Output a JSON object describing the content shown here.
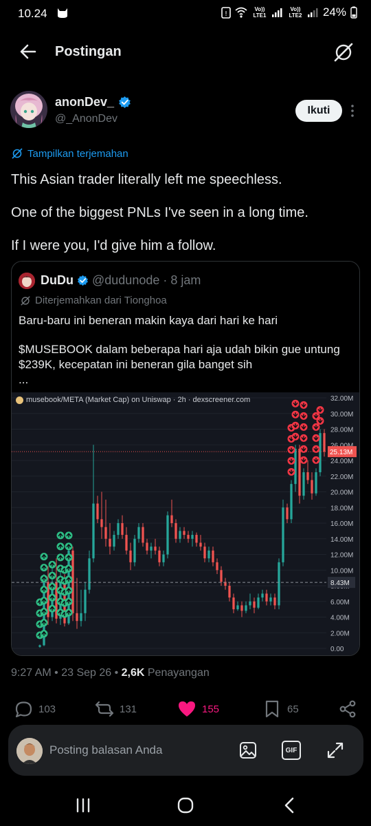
{
  "status_bar": {
    "time": "10.24",
    "sim1": "Vo)) LTE1",
    "sim2": "Vo)) LTE2",
    "battery": "24%"
  },
  "header": {
    "title": "Postingan",
    "back_icon": "arrow-left-icon",
    "grok_icon": "grok-icon"
  },
  "post": {
    "author_name": "anonDev_",
    "author_handle": "@_AnonDev",
    "follow_label": "Ikuti",
    "translate_label": "Tampilkan terjemahan",
    "text_lines": [
      "This Asian trader literally left me speechless.",
      "One of the biggest PNLs I've seen in a long time.",
      "If I were you, I'd give him a follow."
    ],
    "timestamp": "9:27 AM • 23 Sep 26 • ",
    "views": "2,6K",
    "views_label": " Penayangan"
  },
  "quote": {
    "name": "DuDu",
    "handle": "@dudunode",
    "time": "· 8 jam",
    "translated_from": "Diterjemahkan dari Tionghoa",
    "line1": "Baru-baru ini beneran makin kaya dari hari ke hari",
    "line2": "$MUSEBOOK dalam beberapa hari aja udah bikin gue untung",
    "line3": "$239K, kecepatan ini beneran gila banget sih",
    "ellipsis": "..."
  },
  "actions": {
    "replies": "103",
    "reposts": "131",
    "likes": "155",
    "bookmarks": "65",
    "like_color": "#f91880"
  },
  "reply_bar": {
    "placeholder": "Posting balasan Anda",
    "gif_label": "GIF"
  },
  "colors": {
    "accent": "#1d9bf0",
    "up": "#26a69a",
    "down": "#ef5350",
    "buy_marker": "#2ebd85",
    "sell_marker": "#f23645"
  },
  "chart_data": {
    "type": "candlestick",
    "title": "musebook/META (Market Cap) on Uniswap · 2h · dexscreener.com",
    "y_ticks": [
      "0.00",
      "2.00M",
      "4.00M",
      "6.00M",
      "8.00M",
      "10.00M",
      "12.00M",
      "14.00M",
      "16.00M",
      "18.00M",
      "20.00M",
      "22.00M",
      "24.00M",
      "26.00M",
      "28.00M",
      "30.00M",
      "32.00M"
    ],
    "ylim": [
      0,
      32
    ],
    "unit": "M",
    "last_price_label": "25.13M",
    "last_price": 25.13,
    "crosshair_label": "8.43M",
    "crosshair_value": 8.43,
    "candles": [
      [
        0.2,
        0.5,
        0.1,
        0.4
      ],
      [
        0.4,
        9.5,
        0.3,
        8.5
      ],
      [
        8.5,
        10.5,
        3.0,
        4.0
      ],
      [
        4.0,
        11.0,
        3.5,
        8.5
      ],
      [
        8.5,
        11.5,
        3.2,
        3.8
      ],
      [
        3.8,
        10.0,
        3.0,
        9.0
      ],
      [
        9.0,
        9.5,
        2.8,
        3.2
      ],
      [
        3.2,
        13.5,
        3.0,
        12.5
      ],
      [
        12.5,
        13.0,
        3.5,
        4.5
      ],
      [
        4.5,
        9.0,
        2.5,
        3.5
      ],
      [
        3.5,
        7.5,
        2.8,
        4.5
      ],
      [
        4.5,
        8.5,
        3.5,
        7.5
      ],
      [
        7.5,
        12.5,
        7.0,
        11.5
      ],
      [
        11.5,
        26.0,
        11.0,
        18.5
      ],
      [
        18.5,
        19.5,
        16.0,
        16.5
      ],
      [
        16.5,
        20.0,
        14.0,
        15.5
      ],
      [
        15.5,
        19.0,
        13.0,
        14.0
      ],
      [
        14.0,
        16.0,
        12.0,
        13.0
      ],
      [
        13.0,
        15.0,
        12.5,
        14.5
      ],
      [
        14.5,
        16.5,
        14.0,
        16.0
      ],
      [
        16.0,
        17.0,
        14.0,
        14.5
      ],
      [
        14.5,
        15.5,
        12.0,
        12.5
      ],
      [
        12.5,
        13.5,
        10.0,
        11.0
      ],
      [
        11.0,
        14.5,
        10.5,
        14.0
      ],
      [
        14.0,
        16.0,
        13.5,
        15.5
      ],
      [
        15.5,
        16.0,
        13.0,
        13.5
      ],
      [
        13.5,
        14.0,
        12.0,
        12.5
      ],
      [
        12.5,
        13.5,
        11.5,
        13.0
      ],
      [
        13.0,
        14.0,
        12.0,
        12.5
      ],
      [
        12.5,
        13.0,
        10.5,
        11.0
      ],
      [
        11.0,
        12.5,
        10.5,
        12.0
      ],
      [
        12.0,
        17.5,
        11.5,
        17.0
      ],
      [
        17.0,
        19.0,
        15.5,
        16.0
      ],
      [
        16.0,
        16.5,
        13.5,
        14.0
      ],
      [
        14.0,
        15.5,
        13.5,
        15.0
      ],
      [
        15.0,
        15.5,
        14.0,
        14.5
      ],
      [
        14.5,
        15.0,
        13.5,
        14.0
      ],
      [
        14.0,
        15.0,
        13.0,
        14.5
      ],
      [
        14.5,
        14.8,
        13.0,
        13.5
      ],
      [
        13.5,
        14.5,
        12.5,
        13.0
      ],
      [
        13.0,
        13.5,
        11.0,
        11.5
      ],
      [
        11.5,
        13.0,
        11.0,
        12.5
      ],
      [
        12.5,
        13.0,
        10.5,
        11.0
      ],
      [
        11.0,
        11.5,
        9.5,
        10.0
      ],
      [
        10.0,
        10.5,
        8.0,
        8.5
      ],
      [
        8.5,
        9.0,
        7.5,
        8.0
      ],
      [
        8.0,
        8.5,
        6.0,
        6.5
      ],
      [
        6.5,
        7.0,
        4.5,
        5.0
      ],
      [
        5.0,
        6.0,
        4.8,
        5.5
      ],
      [
        5.5,
        6.0,
        4.0,
        4.8
      ],
      [
        4.8,
        6.0,
        4.5,
        5.5
      ],
      [
        5.5,
        7.0,
        5.0,
        6.0
      ],
      [
        6.0,
        6.5,
        4.5,
        5.2
      ],
      [
        5.2,
        7.0,
        5.0,
        6.5
      ],
      [
        6.5,
        7.5,
        6.0,
        7.0
      ],
      [
        7.0,
        7.5,
        5.5,
        6.0
      ],
      [
        6.0,
        7.0,
        5.5,
        6.5
      ],
      [
        6.5,
        7.0,
        5.0,
        5.5
      ],
      [
        5.5,
        11.5,
        5.0,
        11.0
      ],
      [
        11.0,
        19.0,
        10.5,
        18.0
      ],
      [
        18.0,
        18.5,
        16.0,
        16.5
      ],
      [
        16.5,
        21.5,
        16.0,
        21.0
      ],
      [
        21.0,
        26.0,
        20.0,
        25.5
      ],
      [
        25.5,
        26.0,
        18.5,
        19.5
      ],
      [
        19.5,
        23.0,
        19.0,
        22.5
      ],
      [
        22.5,
        24.0,
        21.0,
        21.5
      ],
      [
        21.5,
        22.5,
        19.0,
        19.8
      ],
      [
        19.8,
        23.0,
        19.5,
        22.5
      ],
      [
        22.5,
        28.0,
        22.0,
        27.5
      ],
      [
        27.5,
        28.0,
        24.5,
        25.13
      ]
    ],
    "buy_markers_candle_index": [
      0,
      1,
      3,
      5,
      6,
      7
    ],
    "sell_markers_candle_index": [
      61,
      62,
      64,
      67,
      68
    ]
  }
}
